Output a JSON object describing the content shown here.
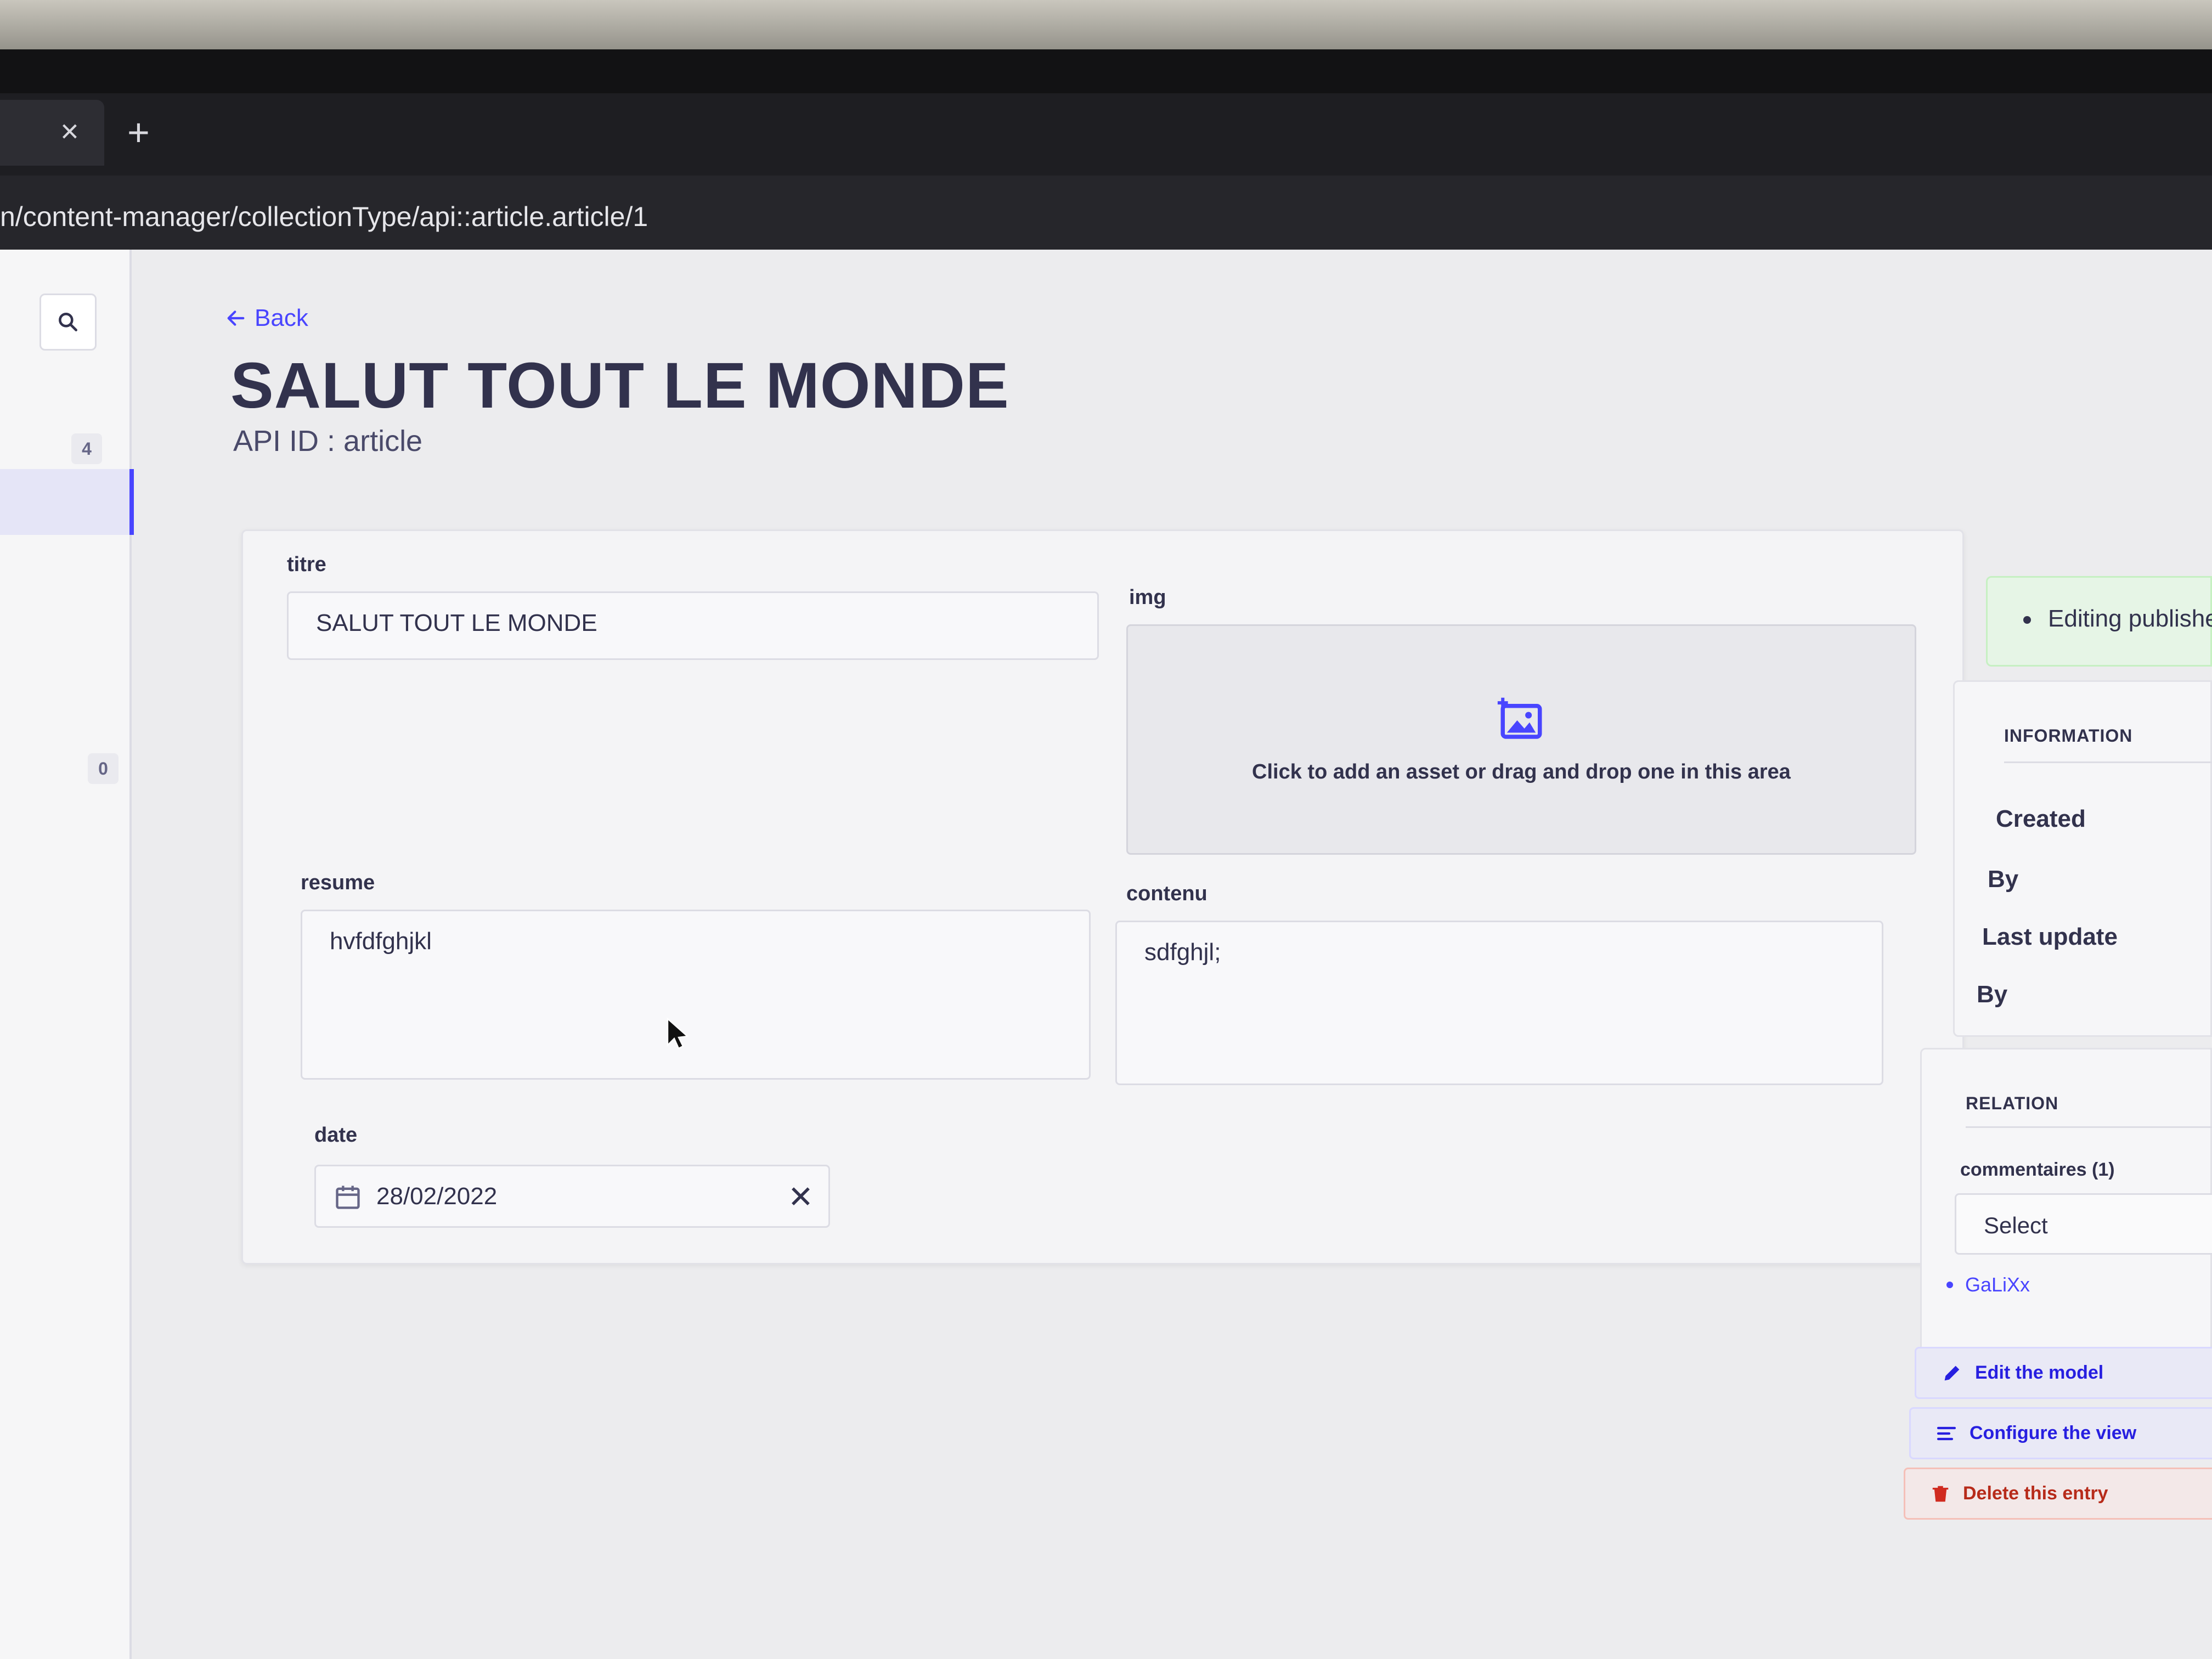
{
  "browser": {
    "tab_close": "×",
    "new_tab": "+",
    "url": "n/content-manager/collectionType/api::article.article/1"
  },
  "sidebar": {
    "badge_top": "4",
    "badge_bottom": "0"
  },
  "header": {
    "back_label": "Back",
    "title": "SALUT TOUT LE MONDE",
    "api_id": "API ID : article"
  },
  "form": {
    "titre": {
      "label": "titre",
      "value": "SALUT TOUT LE MONDE"
    },
    "img": {
      "label": "img",
      "hint": "Click to add an asset or drag and drop one in this area"
    },
    "resume": {
      "label": "resume",
      "value": "hvfdfghjkl"
    },
    "contenu": {
      "label": "contenu",
      "value": "sdfghjl;"
    },
    "date": {
      "label": "date",
      "value": "28/02/2022"
    }
  },
  "status": {
    "text": "Editing publishe"
  },
  "information": {
    "heading": "INFORMATION",
    "created": "Created",
    "created_by": "By",
    "last_update": "Last update",
    "updated_by": "By"
  },
  "relation": {
    "heading": "RELATION",
    "field_label": "commentaires (1)",
    "select_placeholder": "Select",
    "items": [
      "GaLiXx"
    ]
  },
  "actions": {
    "edit_model": "Edit the model",
    "configure_view": "Configure the view",
    "delete_entry": "Delete this entry"
  },
  "colors": {
    "primary": "#4945ff",
    "danger": "#d02b20",
    "success_bg": "#eafbe7"
  }
}
